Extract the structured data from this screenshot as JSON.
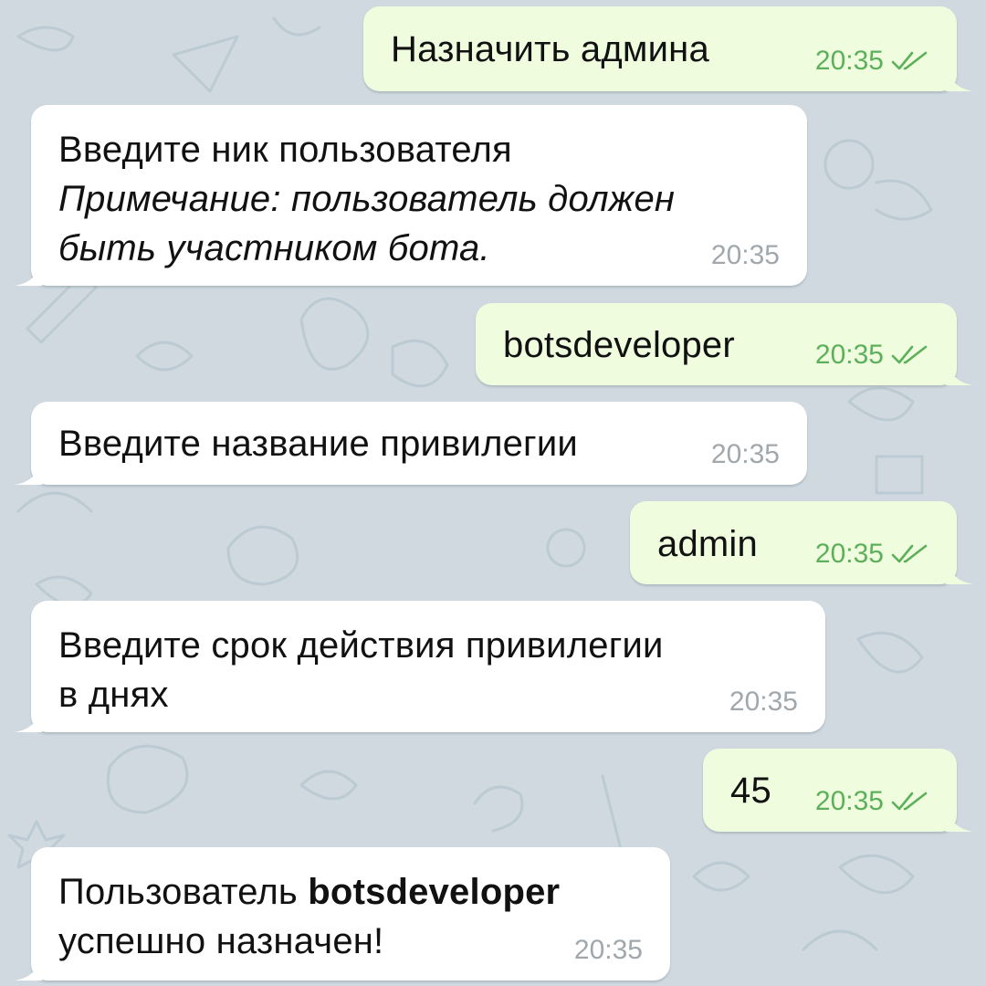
{
  "colors": {
    "background": "#cfd9df",
    "outgoing_bubble": "#effdde",
    "incoming_bubble": "#ffffff",
    "outgoing_time": "#5db05b",
    "incoming_time": "#a0a8ad",
    "read_checks": "#5db05b"
  },
  "messages": [
    {
      "direction": "outgoing",
      "text": "Назначить админа",
      "time": "20:35",
      "status_icon": "double-check-icon"
    },
    {
      "direction": "incoming",
      "line1": "Введите ник пользователя",
      "note_line1": "Примечание: пользователь должен",
      "note_line2": "быть участником бота.",
      "time": "20:35"
    },
    {
      "direction": "outgoing",
      "text": "botsdeveloper",
      "time": "20:35",
      "status_icon": "double-check-icon"
    },
    {
      "direction": "incoming",
      "text": "Введите название привилегии",
      "time": "20:35"
    },
    {
      "direction": "outgoing",
      "text": "admin",
      "time": "20:35",
      "status_icon": "double-check-icon"
    },
    {
      "direction": "incoming",
      "line1": "Введите срок действия привилегии",
      "line2": "в днях",
      "time": "20:35"
    },
    {
      "direction": "outgoing",
      "text": "45",
      "time": "20:35",
      "status_icon": "double-check-icon"
    },
    {
      "direction": "incoming",
      "prefix": "Пользователь ",
      "bold": "botsdeveloper",
      "line2": "успешно назначен!",
      "time": "20:35"
    }
  ]
}
